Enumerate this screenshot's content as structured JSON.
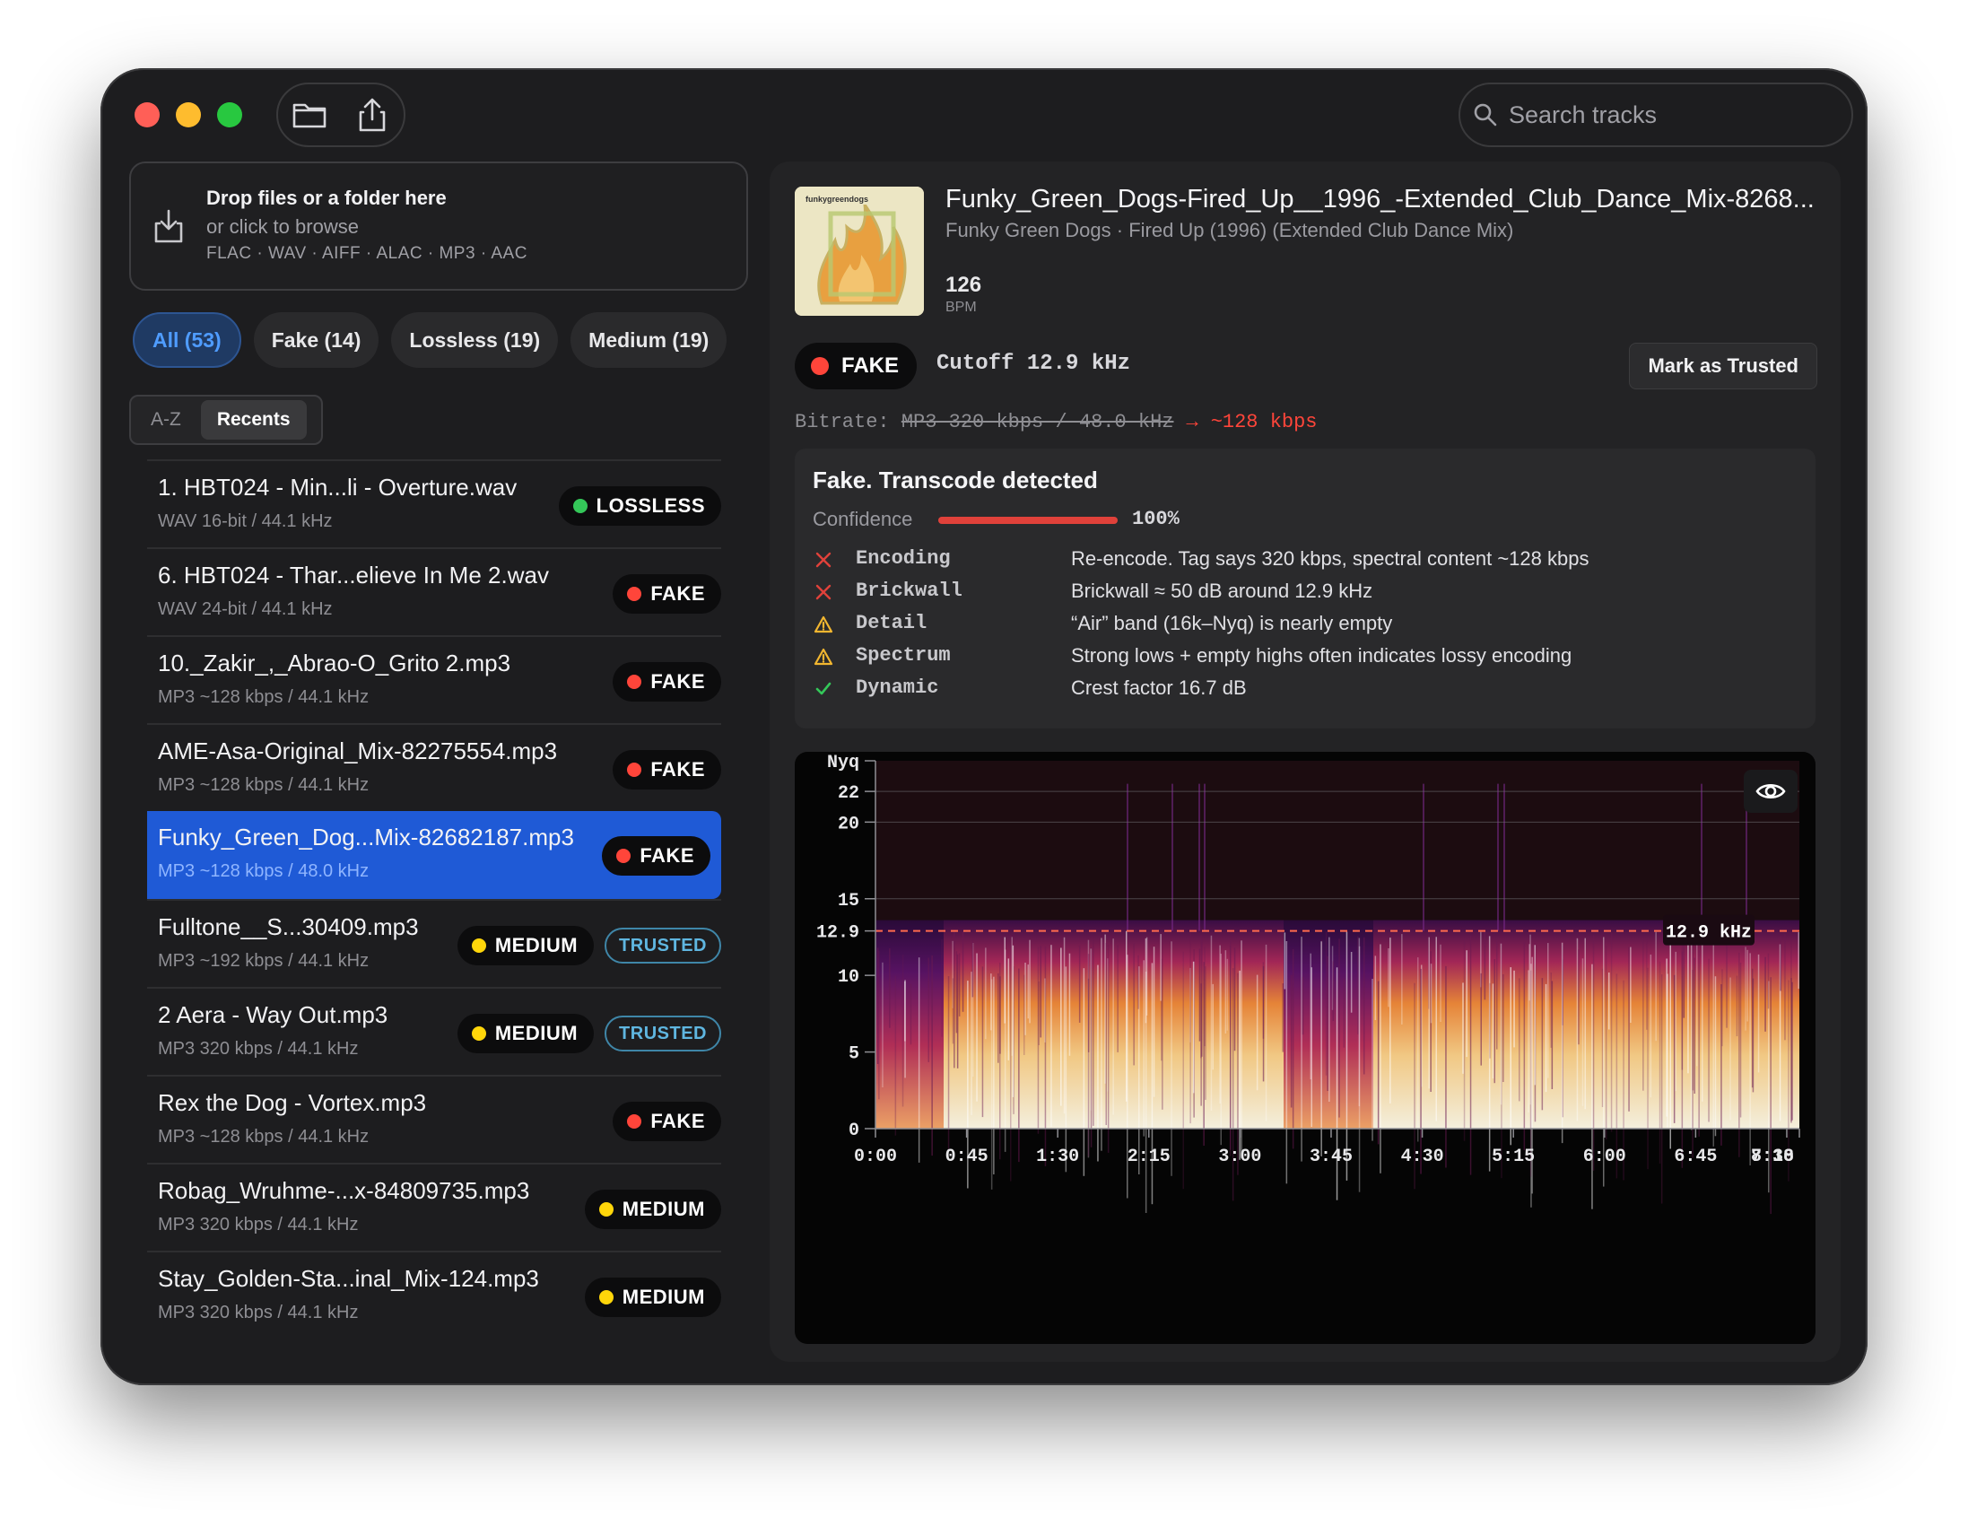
{
  "toolbar": {
    "open_icon": "folder-icon",
    "share_icon": "share-icon",
    "search_placeholder": "Search tracks"
  },
  "dropzone": {
    "title": "Drop files or a folder here",
    "subtitle": "or click to browse",
    "formats": "FLAC · WAV · AIFF · ALAC · MP3 · AAC"
  },
  "filters": [
    {
      "label": "All (53)",
      "active": true
    },
    {
      "label": "Fake (14)",
      "active": false
    },
    {
      "label": "Lossless (19)",
      "active": false
    },
    {
      "label": "Medium (19)",
      "active": false
    }
  ],
  "sort": {
    "az": "A-Z",
    "recents": "Recents"
  },
  "tracks": [
    {
      "name": "1. HBT024 - Min...li - Overture.wav",
      "meta": "WAV 16-bit / 44.1 kHz",
      "badge": "LOSSLESS",
      "badge_color": "#34c759",
      "trusted": ""
    },
    {
      "name": "6. HBT024 - Thar...elieve In Me 2.wav",
      "meta": "WAV 24-bit / 44.1 kHz",
      "badge": "FAKE",
      "badge_color": "#ff453a",
      "trusted": ""
    },
    {
      "name": "10._Zakir_,_Abrao-O_Grito 2.mp3",
      "meta": "MP3 ~128 kbps / 44.1 kHz",
      "badge": "FAKE",
      "badge_color": "#ff453a",
      "trusted": ""
    },
    {
      "name": "AME-Asa-Original_Mix-82275554.mp3",
      "meta": "MP3 ~128 kbps / 44.1 kHz",
      "badge": "FAKE",
      "badge_color": "#ff453a",
      "trusted": ""
    },
    {
      "name": "Funky_Green_Dog...Mix-82682187.mp3",
      "meta": "MP3 ~128 kbps / 48.0 kHz",
      "badge": "FAKE",
      "badge_color": "#ff453a",
      "trusted": "",
      "selected": true
    },
    {
      "name": "Fulltone__S...30409.mp3",
      "meta": "MP3 ~192 kbps / 44.1 kHz",
      "badge": "MEDIUM",
      "badge_color": "#ffd60a",
      "trusted": "TRUSTED"
    },
    {
      "name": "2 Aera - Way Out.mp3",
      "meta": "MP3 320 kbps / 44.1 kHz",
      "badge": "MEDIUM",
      "badge_color": "#ffd60a",
      "trusted": "TRUSTED"
    },
    {
      "name": "Rex the Dog - Vortex.mp3",
      "meta": "MP3 ~128 kbps / 44.1 kHz",
      "badge": "FAKE",
      "badge_color": "#ff453a",
      "trusted": ""
    },
    {
      "name": "Robag_Wruhme-...x-84809735.mp3",
      "meta": "MP3 320 kbps / 44.1 kHz",
      "badge": "MEDIUM",
      "badge_color": "#ffd60a",
      "trusted": ""
    },
    {
      "name": "Stay_Golden-Sta...inal_Mix-124.mp3",
      "meta": "MP3 320 kbps / 44.1 kHz",
      "badge": "MEDIUM",
      "badge_color": "#ffd60a",
      "trusted": ""
    }
  ],
  "detail": {
    "title": "Funky_Green_Dogs-Fired_Up__1996_-Extended_Club_Dance_Mix-8268...",
    "artist_line": "Funky Green Dogs · Fired Up (1996) (Extended Club Dance Mix)",
    "bpm": "126",
    "bpm_label": "BPM",
    "art_text": "funkygreendogs",
    "verdict": "FAKE",
    "verdict_color": "#ff453a",
    "cutoff": "Cutoff 12.9 kHz",
    "mark_trusted": "Mark as Trusted",
    "bitrate_label": "Bitrate:",
    "bitrate_claimed": "MP3 320 kbps / 48.0 kHz",
    "bitrate_arrow": "→",
    "bitrate_estimated": "~128 kbps"
  },
  "analysis": {
    "title": "Fake. Transcode detected",
    "confidence_label": "Confidence",
    "confidence": 1.0,
    "confidence_text": "100%",
    "checks": [
      {
        "status": "fail",
        "name": "Encoding",
        "desc": "Re-encode. Tag says 320 kbps, spectral content ~128 kbps"
      },
      {
        "status": "fail",
        "name": "Brickwall",
        "desc": "Brickwall ≈ 50 dB around 12.9 kHz"
      },
      {
        "status": "warn",
        "name": "Detail",
        "desc": "“Air” band (16k–Nyq) is nearly empty"
      },
      {
        "status": "warn",
        "name": "Spectrum",
        "desc": "Strong lows + empty highs often indicates lossy encoding"
      },
      {
        "status": "pass",
        "name": "Dynamic",
        "desc": "Crest factor 16.7 dB"
      }
    ]
  },
  "spectrogram": {
    "y_ticks": [
      {
        "label": "Nyq",
        "khz": 24
      },
      {
        "label": "22",
        "khz": 22
      },
      {
        "label": "20",
        "khz": 20
      },
      {
        "label": "15",
        "khz": 15
      },
      {
        "label": "12.9",
        "khz": 12.9
      },
      {
        "label": "10",
        "khz": 10
      },
      {
        "label": "5",
        "khz": 5
      },
      {
        "label": "0",
        "khz": 0
      }
    ],
    "x_ticks": [
      "0:00",
      "0:45",
      "1:30",
      "2:15",
      "3:00",
      "3:45",
      "4:30",
      "5:15",
      "6:00",
      "6:45",
      "7:30",
      "8:18"
    ],
    "cutoff_label": "12.9 kHz",
    "cutoff_khz": 12.9,
    "max_khz": 24,
    "eye_icon": "eye-icon"
  }
}
